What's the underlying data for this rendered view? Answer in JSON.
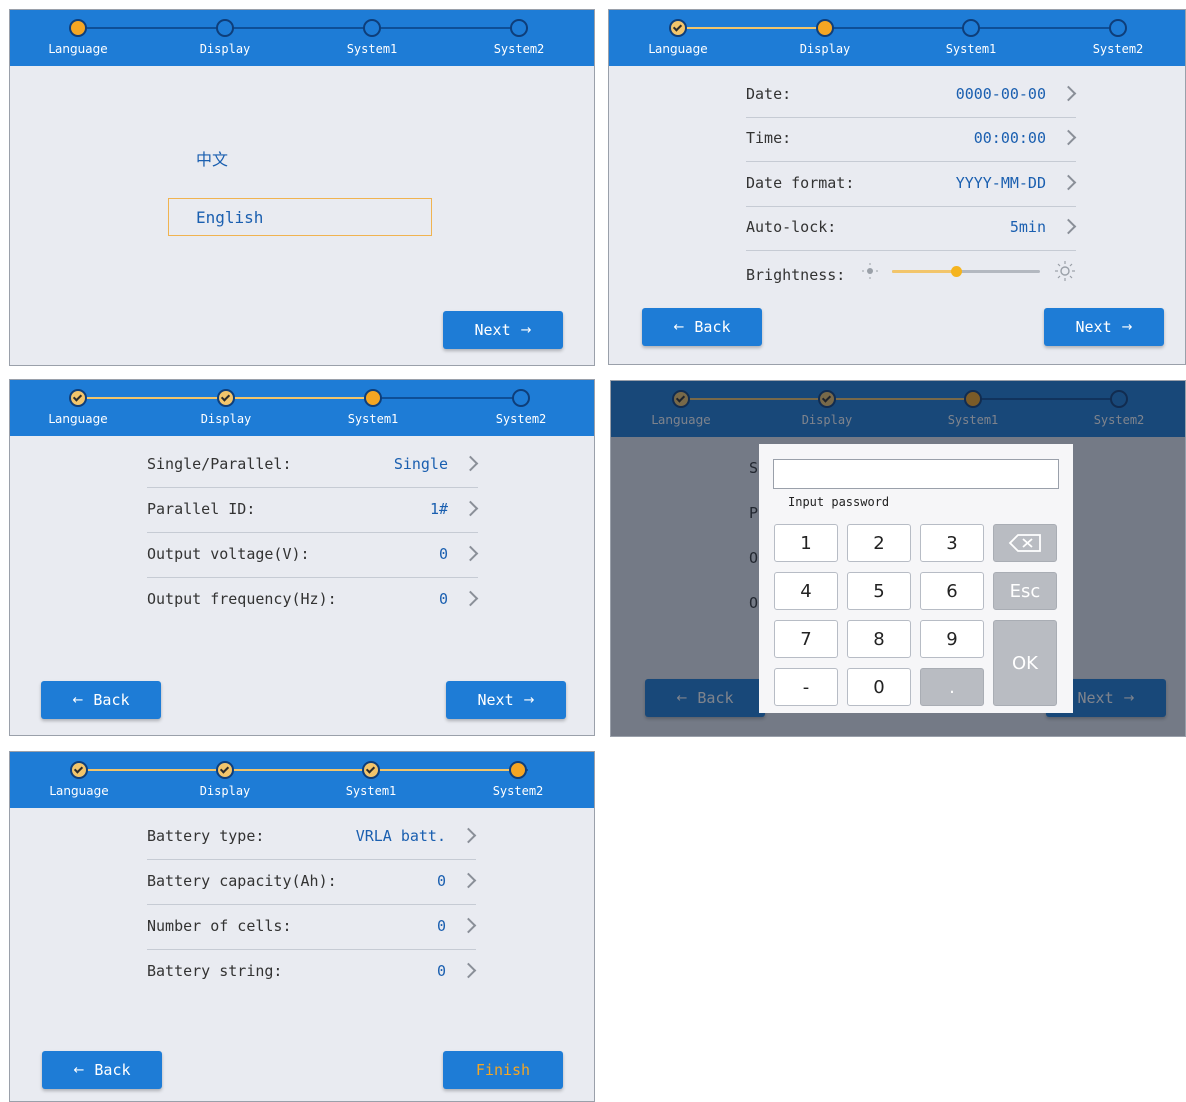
{
  "steps": [
    "Language",
    "Display",
    "System1",
    "System2"
  ],
  "buttons": {
    "next": "Next",
    "back": "Back",
    "finish": "Finish",
    "next_arrow": "→",
    "back_arrow": "←"
  },
  "screen_language": {
    "options": [
      "中文",
      "English"
    ],
    "selected": "English"
  },
  "screen_display": {
    "rows": [
      {
        "label": "Date:",
        "value": "0000-00-00"
      },
      {
        "label": "Time:",
        "value": "00:00:00"
      },
      {
        "label": "Date format:",
        "value": "YYYY-MM-DD"
      },
      {
        "label": "Auto-lock:",
        "value": "5min"
      }
    ],
    "brightness_label": "Brightness:",
    "brightness_level": 0.43
  },
  "screen_system1": {
    "rows": [
      {
        "label": "Single/Parallel:",
        "value": "Single"
      },
      {
        "label": "Parallel ID:",
        "value": "1#"
      },
      {
        "label": "Output voltage(V):",
        "value": "0"
      },
      {
        "label": "Output frequency(Hz):",
        "value": "0"
      }
    ],
    "visible_letters": [
      "S",
      "P",
      "O",
      "O"
    ]
  },
  "password_dialog": {
    "prompt": "Input password",
    "keys": [
      "1",
      "2",
      "3",
      "4",
      "5",
      "6",
      "7",
      "8",
      "9",
      "-",
      "0",
      "."
    ],
    "esc": "Esc",
    "ok": "OK"
  },
  "screen_system2": {
    "rows": [
      {
        "label": "Battery type:",
        "value": "VRLA batt."
      },
      {
        "label": "Battery capacity(Ah):",
        "value": "0"
      },
      {
        "label": "Number of cells:",
        "value": "0"
      },
      {
        "label": "Battery string:",
        "value": "0"
      }
    ]
  },
  "colors": {
    "header": "#1e7cd6",
    "accent": "#f5a623",
    "finish_text": "#f5a623",
    "value_text": "#1a5fb0"
  }
}
